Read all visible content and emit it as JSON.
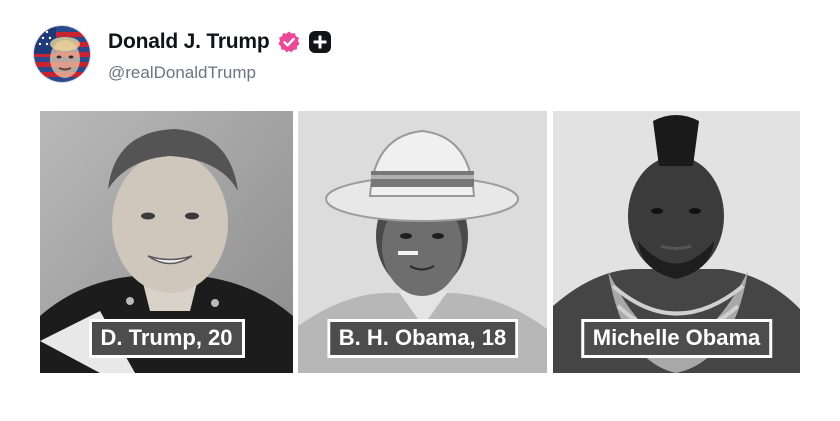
{
  "post": {
    "author": {
      "display_name": "Donald J. Trump",
      "handle": "@realDonaldTrump",
      "avatar_icon": "flag-face-avatar",
      "verified_icon": "verified-badge-icon",
      "verified_color": "#ec4899",
      "extra_badge_icon": "plus-square-icon"
    },
    "photos": [
      {
        "caption": "D. Trump, 20",
        "subject": "young-man-military-uniform"
      },
      {
        "caption": "B. H. Obama, 18",
        "subject": "young-man-straw-hat"
      },
      {
        "caption": "Michelle Obama",
        "subject": "man-mohawk-gold-chains"
      }
    ]
  },
  "colors": {
    "text_primary": "#101418",
    "text_secondary": "#6b7580",
    "caption_bg": "#4d4d4d"
  }
}
